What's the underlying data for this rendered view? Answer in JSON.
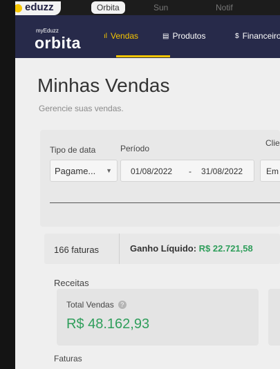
{
  "top_bar": {
    "logo_text": "eduzz",
    "tab_text": "Orbita",
    "ghost_items": [
      "Sun",
      "Notif"
    ]
  },
  "nav": {
    "brand_small": "myEduzz",
    "brand": "orbita",
    "items": [
      {
        "label": "Vendas",
        "icon": "chart-bars-icon",
        "active": true
      },
      {
        "label": "Produtos",
        "icon": "box-icon",
        "active": false
      },
      {
        "label": "Financeiro",
        "icon": "dollar-icon",
        "active": false
      }
    ],
    "accent_color": "#f6c500",
    "background_color": "#272a4a"
  },
  "page": {
    "title": "Minhas Vendas",
    "subtitle": "Gerencie suas vendas."
  },
  "filters": {
    "tipo_label": "Tipo de data",
    "periodo_label": "Período",
    "cliente_label": "Clie",
    "tipo_value": "Pagame...",
    "date_from": "01/08/2022",
    "date_sep": "-",
    "date_to": "31/08/2022",
    "cliente_value": "Em"
  },
  "stats": {
    "count": "166 faturas",
    "gain_label": "Ganho Líquido:",
    "gain_value": "R$ 22.721,58"
  },
  "receitas": {
    "section": "Receitas",
    "total_label": "Total Vendas",
    "total_value": "R$ 48.162,93",
    "value_color": "#2f9e5b"
  },
  "faturas": {
    "section": "Faturas"
  }
}
